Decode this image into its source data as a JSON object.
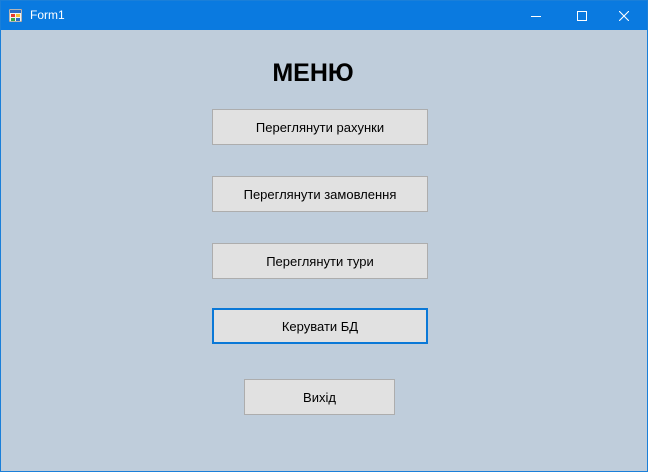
{
  "window": {
    "title": "Form1",
    "controls": {
      "minimize_icon": "minimize-icon",
      "maximize_icon": "maximize-icon",
      "close_icon": "close-icon"
    }
  },
  "menu": {
    "title": "МЕНЮ",
    "buttons": [
      "Переглянути рахунки",
      "Переглянути замовлення",
      "Переглянути тури",
      "Керувати БД",
      "Вихід"
    ]
  },
  "colors": {
    "titlebar": "#0a7ae0",
    "background": "#bfcddb",
    "button": "#e1e1e1",
    "focus_border": "#0a78d7"
  }
}
